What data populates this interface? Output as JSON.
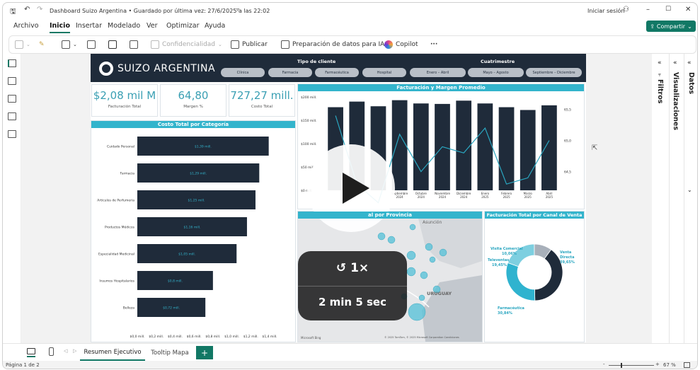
{
  "window": {
    "title": "Dashboard Suizo Argentina • Guardado por última vez: 27/6/2025 a las 22:02",
    "signin": "Iniciar sesión",
    "min": "–",
    "max": "☐",
    "close": "✕"
  },
  "menu": {
    "items": [
      "Archivo",
      "Inicio",
      "Insertar",
      "Modelado",
      "Ver",
      "Optimizar",
      "Ayuda"
    ],
    "share": "Compartir"
  },
  "ribbon": {
    "confidentiality": "Confidencialidad",
    "publish": "Publicar",
    "prep": "Preparación de datos para IA",
    "copilot": "Copilot",
    "more": "···"
  },
  "report": {
    "brand": "SUIZO ARGENTINA",
    "slicer_client_label": "Tipo de cliente",
    "slicer_client": [
      "Clínica",
      "Farmacia",
      "Farmacéutica",
      "Hospital"
    ],
    "slicer_quarter_label": "Cuatrimestre",
    "slicer_quarter": [
      "Enero – Abril",
      "Mayo – Agosto",
      "Septiembre – Diciembre"
    ],
    "kpis": [
      {
        "value": "$2,08 mil M",
        "label": "Facturación Total"
      },
      {
        "value": "64,80",
        "label": "Margen %"
      },
      {
        "value": "727,27 mill.",
        "label": "Costo Total"
      }
    ],
    "cost_title": "Costo Total por Categoría",
    "revenue_title": "Facturación y Margen Promedio",
    "map_title": "Facturación Total por Provincia",
    "map_visible_title": "al por Provincia",
    "map_labels": [
      "Asunción",
      "URUGUAY"
    ],
    "map_footer": "© 2025 TomTom, © 2025 Microsoft Corporation Condiciones",
    "map_brand": "Microsoft Bing",
    "donut_title": "Facturación Total por Canal de Venta",
    "donut_labels": [
      {
        "name": "Visita Comercial",
        "pct": "10,06%"
      },
      {
        "name": "Televentas",
        "pct": "19,45%"
      },
      {
        "name": "Venta Directa",
        "pct": "39,65%"
      },
      {
        "name": "Farmacéutica",
        "pct": "30,84%"
      }
    ]
  },
  "chart_data": [
    {
      "type": "bar",
      "title": "Costo Total por Categoría",
      "categories": [
        "Cuidado Personal",
        "Farmacia",
        "Artículos de Perfumería",
        "Productos Médicos",
        "Especialidad Medicinal",
        "Insumos Hospitalarios",
        "Belleza"
      ],
      "values": [
        1.39,
        1.29,
        1.25,
        1.16,
        1.05,
        0.8,
        0.72
      ],
      "value_labels": [
        "$1,39 mill.",
        "$1,29 mill.",
        "$1,25 mill.",
        "$1,16 mill.",
        "$1,05 mill.",
        "$0,8 mill.",
        "$0,72 mill."
      ],
      "x_ticks": [
        "$0,0 mill.",
        "$0,2 mill.",
        "$0,4 mill.",
        "$0,6 mill.",
        "$0,8 mill.",
        "$1,0 mill.",
        "$1,2 mill.",
        "$1,4 mill."
      ],
      "xlim": [
        0,
        1.4
      ],
      "color": "#1f2b3a"
    },
    {
      "type": "bar",
      "title": "Facturación y Margen Promedio",
      "categories": [
        "",
        "",
        "",
        "Septiembre 2024",
        "Octubre 2024",
        "Noviembre 2024",
        "Diciembre 2024",
        "Enero 2025",
        "Febrero 2025",
        "Marzo 2025",
        "Abril 2025"
      ],
      "values": [
        178,
        190,
        180,
        193,
        186,
        185,
        192,
        186,
        178,
        172,
        182
      ],
      "y_ticks": [
        "$200 mill.",
        "$150 mill.",
        "$100 mill.",
        "$50 mill.",
        "$0 mill."
      ],
      "ylim": [
        0,
        200
      ],
      "line_values": [
        65.4,
        64.3,
        64.0,
        65.1,
        64.5,
        64.9,
        64.8,
        65.2,
        64.3,
        64.4,
        65.0
      ],
      "y2_ticks": [
        "65,5",
        "65,0",
        "64,5"
      ],
      "y2lim": [
        64.2,
        65.7
      ],
      "color": "#1f2b3a",
      "line_color": "#2aa6c0"
    },
    {
      "type": "pie",
      "title": "Facturación Total por Canal de Venta",
      "categories": [
        "Venta Directa",
        "Farmacéutica",
        "Televentas",
        "Visita Comercial"
      ],
      "values": [
        39.65,
        30.84,
        19.45,
        10.06
      ],
      "colors": [
        "#1f2b3a",
        "#2fb3cf",
        "#7dcfe0",
        "#a8b0ba"
      ]
    }
  ],
  "tabs": {
    "items": [
      "Resumen Ejecutivo",
      "Tooltip Mapa"
    ],
    "add": "+"
  },
  "status": {
    "page": "Página 1 de 2",
    "zoom": "67 %"
  },
  "panes": {
    "filters": "Filtros",
    "visualizations": "Visualizaciones",
    "data": "Datos"
  },
  "overlay": {
    "speed": "1×",
    "duration": "2 min 5 sec"
  }
}
